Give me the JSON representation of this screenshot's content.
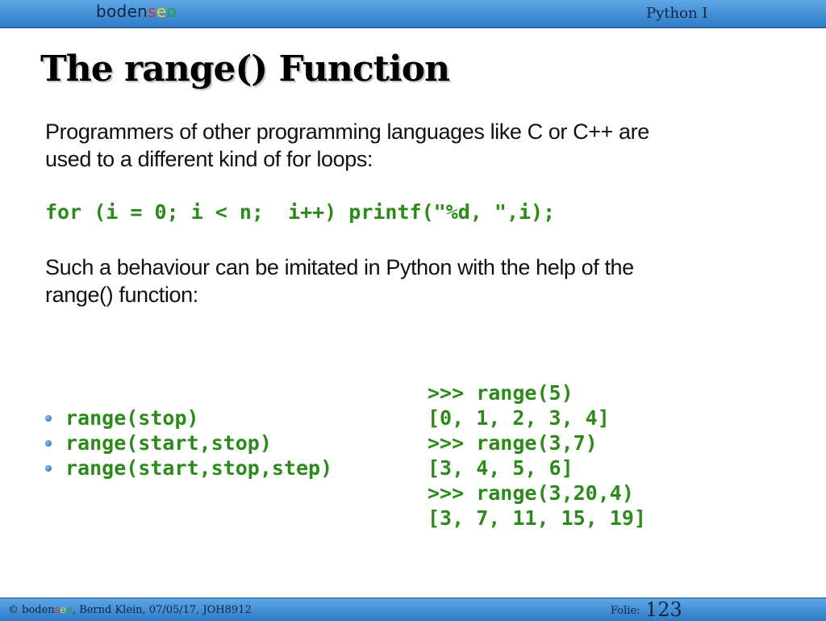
{
  "header": {
    "brand_parts": [
      "boden",
      "s",
      "e",
      "o"
    ],
    "course": "Python I"
  },
  "slide": {
    "title": "The range() Function",
    "para1_line1": "Programmers of other programming languages like  C or C++ are",
    "para1_line2": "used to a different kind of for loops:",
    "for_loop_code": "for (i = 0; i < n;  i++) printf(\"%d, \",i);",
    "para2_line1": "Such a behaviour can be imitated in Python with the help of the",
    "para2_line2": "range() function:",
    "bullets": [
      "range(stop)",
      "range(start,stop)",
      "range(start,stop,step)"
    ],
    "repl_lines": [
      ">>> range(5)",
      "[0, 1, 2, 3, 4]",
      ">>> range(3,7)",
      "[3, 4, 5, 6]",
      ">>> range(3,20,4)",
      "[3, 7, 11, 15, 19]"
    ]
  },
  "footer": {
    "copyright_prefix": "© ",
    "brand_parts": [
      "boden",
      "s",
      "e",
      "o"
    ],
    "credits": ", Bernd Klein, 07/05/17, JOH8912",
    "folie_label": "Folie:",
    "page_number": "123"
  },
  "colors": {
    "bar_blue": "#2f7cc8",
    "code_green": "#2c8a1a",
    "brand_red": "#cf2f2f",
    "brand_yellow": "#f2d12a",
    "brand_green": "#2f9a3a"
  }
}
